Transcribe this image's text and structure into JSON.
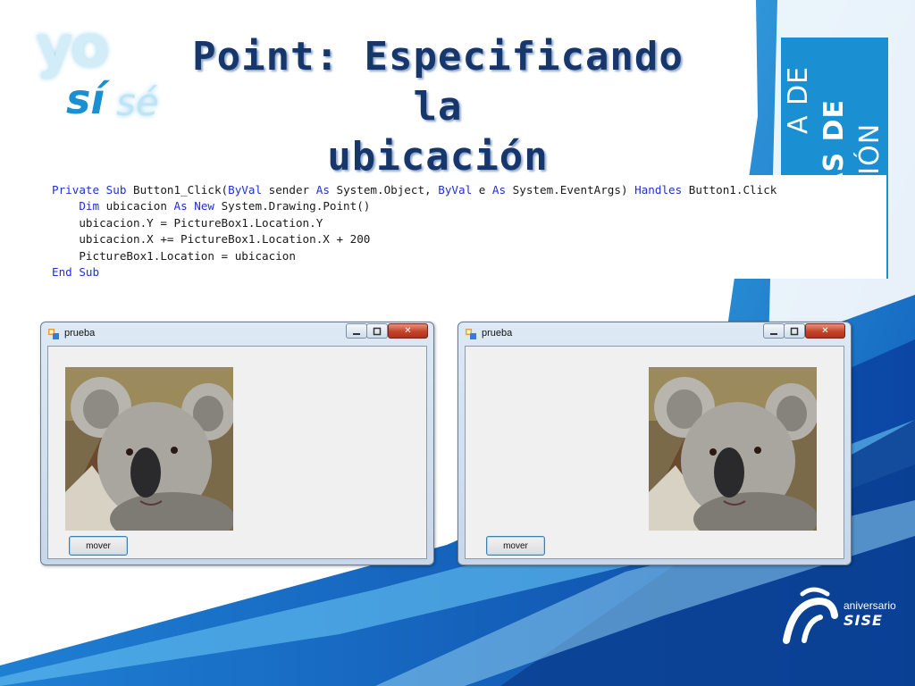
{
  "slide": {
    "title_line1": "Point: Especificando la",
    "title_line2": "ubicación",
    "logo": {
      "part1": "yo",
      "part2": "sí",
      "part3": "sé"
    },
    "banner": {
      "line1": "A DE",
      "line2": "LOGÍAS DE",
      "line3": "ORMACIÓN"
    },
    "anniversary": {
      "label": "aniversario",
      "brand": "SISE"
    }
  },
  "code": {
    "lines": [
      [
        {
          "t": "Private Sub",
          "kw": true
        },
        {
          "t": " Button1_Click(",
          "kw": false
        },
        {
          "t": "ByVal",
          "kw": true
        },
        {
          "t": " sender ",
          "kw": false
        },
        {
          "t": "As",
          "kw": true
        },
        {
          "t": " System.Object, ",
          "kw": false
        },
        {
          "t": "ByVal",
          "kw": true
        },
        {
          "t": " e ",
          "kw": false
        },
        {
          "t": "As",
          "kw": true
        },
        {
          "t": " System.EventArgs) ",
          "kw": false
        },
        {
          "t": "Handles",
          "kw": true
        },
        {
          "t": " Button1.Click",
          "kw": false
        }
      ],
      [
        {
          "t": "    ",
          "kw": false
        },
        {
          "t": "Dim",
          "kw": true
        },
        {
          "t": " ubicacion ",
          "kw": false
        },
        {
          "t": "As New",
          "kw": true
        },
        {
          "t": " System.Drawing.Point()",
          "kw": false
        }
      ],
      [
        {
          "t": "    ubicacion.Y = PictureBox1.Location.Y",
          "kw": false
        }
      ],
      [
        {
          "t": "    ubicacion.X += PictureBox1.Location.X + 200",
          "kw": false
        }
      ],
      [
        {
          "t": "    PictureBox1.Location = ubicacion",
          "kw": false
        }
      ],
      [
        {
          "t": "End Sub",
          "kw": true
        }
      ]
    ]
  },
  "windows": [
    {
      "title": "prueba",
      "minimize_icon": "minimize-icon",
      "maximize_icon": "maximize-icon",
      "close_icon": "close-icon",
      "close_glyph": "✕",
      "button_label": "mover",
      "picture": "koala-photo"
    },
    {
      "title": "prueba",
      "minimize_icon": "minimize-icon",
      "maximize_icon": "maximize-icon",
      "close_icon": "close-icon",
      "close_glyph": "✕",
      "button_label": "mover",
      "picture": "koala-photo"
    }
  ],
  "colors": {
    "title": "#17366c",
    "keyword": "#1f2fd8",
    "brand_blue": "#1a8fd1",
    "dark_blue": "#0a4fa8"
  }
}
